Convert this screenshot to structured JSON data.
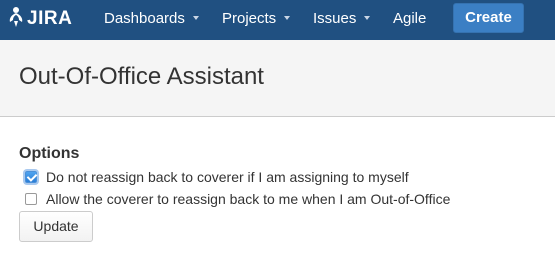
{
  "nav": {
    "logo_text": "JIRA",
    "items": [
      {
        "label": "Dashboards",
        "has_dropdown": true
      },
      {
        "label": "Projects",
        "has_dropdown": true
      },
      {
        "label": "Issues",
        "has_dropdown": true
      },
      {
        "label": "Agile",
        "has_dropdown": false
      }
    ],
    "create_label": "Create",
    "colors": {
      "bar": "#205081",
      "create_button": "#3b7fc4"
    }
  },
  "page": {
    "title": "Out-Of-Office Assistant"
  },
  "options": {
    "heading": "Options",
    "items": [
      {
        "label": "Do not reassign back to coverer if I am assigning to myself",
        "checked": true
      },
      {
        "label": "Allow the coverer to reassign back to me when I am Out-of-Office",
        "checked": false
      }
    ],
    "submit_label": "Update"
  }
}
